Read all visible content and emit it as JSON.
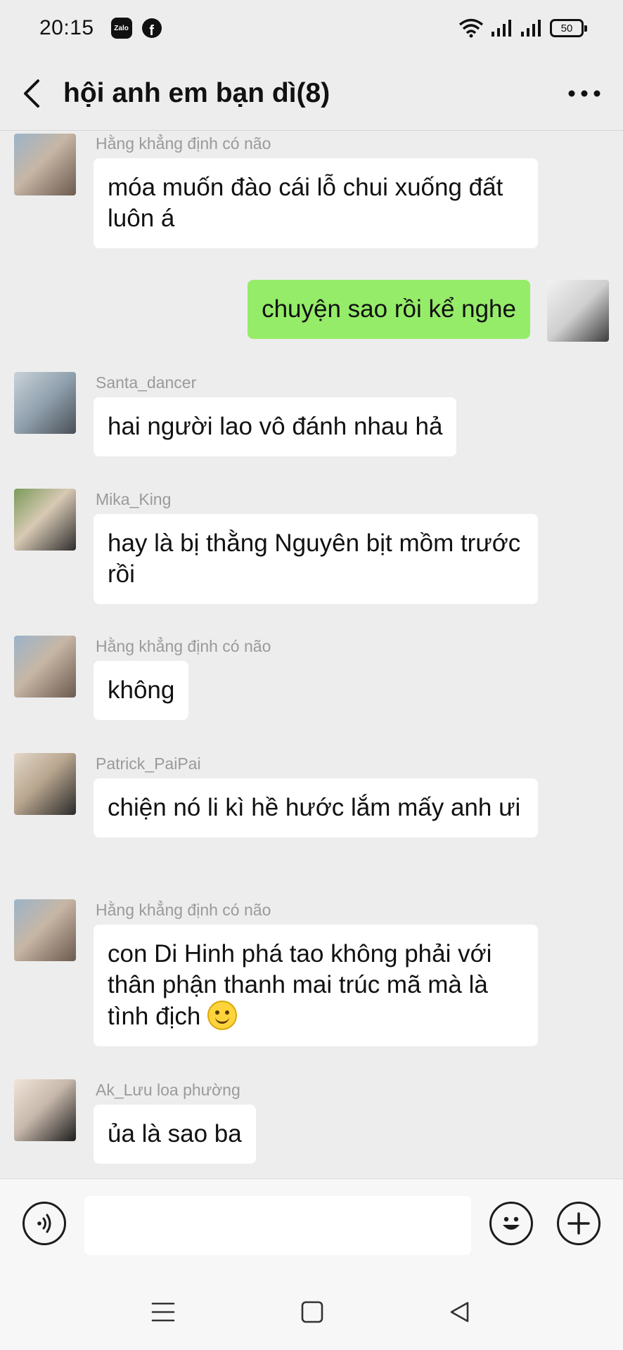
{
  "status_bar": {
    "time": "20:15",
    "app_icon_1": "Zalo",
    "app_icon_2": "f",
    "battery": "50"
  },
  "header": {
    "title": "hội anh em bạn dì(8)",
    "back_icon": "chevron-left-icon",
    "more_icon": "more-horizontal-icon"
  },
  "messages": [
    {
      "sender": "Hằng khẳng định có não",
      "text": "móa muốn đào cái lỗ chui xuống đất luôn á",
      "mine": false
    },
    {
      "sender": "",
      "text": "chuyện sao rồi kể nghe",
      "mine": true
    },
    {
      "sender": "Santa_dancer",
      "text": "hai người lao vô đánh nhau hả",
      "mine": false
    },
    {
      "sender": "Mika_King",
      "text": "hay là bị thằng Nguyên bịt mồm trước rồi",
      "mine": false
    },
    {
      "sender": "Hằng khẳng định có não",
      "text": "không",
      "mine": false
    },
    {
      "sender": "Patrick_PaiPai",
      "text": "chiện nó li kì hề hước lắm mấy anh ưi",
      "mine": false
    },
    {
      "sender": "Hằng khẳng định có não",
      "text": "con Di Hinh phá tao không phải với thân phận thanh mai trúc mã mà là tình địch",
      "mine": false,
      "emoji": "smile-emoji"
    },
    {
      "sender": "Ak_Lưu loa phường",
      "text": "ủa là sao ba",
      "mine": false
    }
  ],
  "input_bar": {
    "voice_icon": "voice-icon",
    "message_value": "",
    "emoji_icon": "emoji-icon",
    "plus_icon": "plus-icon"
  },
  "nav_bar": {
    "menu_icon": "menu-icon",
    "home_icon": "home-square-icon",
    "back_icon": "back-triangle-icon"
  },
  "colors": {
    "background": "#ededed",
    "bubble_other": "#ffffff",
    "bubble_mine": "#95ec69",
    "sender_name": "#9a9a9a"
  }
}
